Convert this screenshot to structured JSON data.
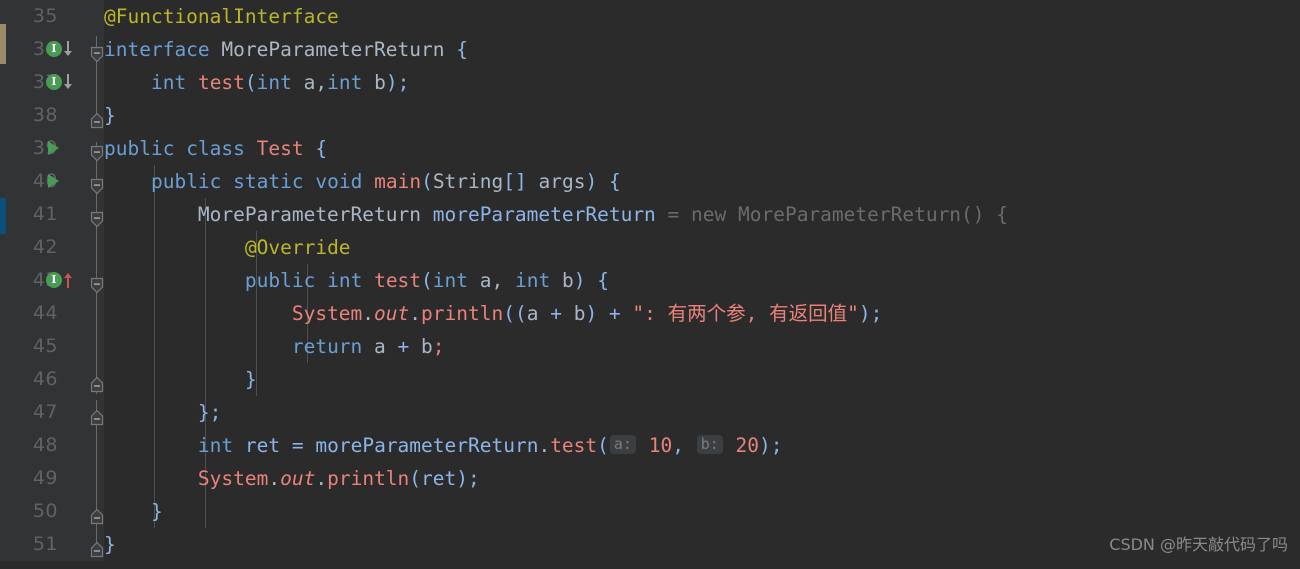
{
  "editor": {
    "background": "#2b2b2b",
    "gutter_background": "#313335",
    "first_line": 35,
    "last_line": 51
  },
  "watermark": {
    "text": "CSDN @昨天敲代码了吗"
  },
  "lines": [
    {
      "number": "35",
      "text": "@FunctionalInterface",
      "indent": 1,
      "gutter_icon": "",
      "fold": "",
      "vcs": "tan"
    },
    {
      "number": "36",
      "text": "interface MoreParameterReturn {",
      "indent": 0,
      "gutter_icon": "implemented-down",
      "fold": "collapse",
      "vcs": "tan"
    },
    {
      "number": "37",
      "text": "    int test(int a,int b);",
      "indent": 1,
      "gutter_icon": "implemented-down",
      "fold": "",
      "vcs": ""
    },
    {
      "number": "38",
      "text": "}",
      "indent": 0,
      "gutter_icon": "",
      "fold": "end",
      "vcs": ""
    },
    {
      "number": "39",
      "text": "public class Test {",
      "indent": 0,
      "gutter_icon": "run",
      "fold": "collapse",
      "vcs": ""
    },
    {
      "number": "40",
      "text": "    public static void main(String[] args) {",
      "indent": 1,
      "gutter_icon": "run",
      "fold": "collapse",
      "vcs": ""
    },
    {
      "number": "41",
      "text": "        MoreParameterReturn moreParameterReturn = new MoreParameterReturn() {",
      "indent": 2,
      "gutter_icon": "",
      "fold": "collapse",
      "vcs": "blue"
    },
    {
      "number": "42",
      "text": "            @Override",
      "indent": 3,
      "gutter_icon": "",
      "fold": "",
      "vcs": ""
    },
    {
      "number": "43",
      "text": "            public int test(int a, int b) {",
      "indent": 3,
      "gutter_icon": "overrides-up",
      "fold": "collapse",
      "vcs": ""
    },
    {
      "number": "44",
      "text": "                System.out.println((a + b) + \": 有两个参, 有返回值\");",
      "indent": 4,
      "gutter_icon": "",
      "fold": "",
      "vcs": ""
    },
    {
      "number": "45",
      "text": "                return a + b;",
      "indent": 4,
      "gutter_icon": "",
      "fold": "",
      "vcs": ""
    },
    {
      "number": "46",
      "text": "            }",
      "indent": 3,
      "gutter_icon": "",
      "fold": "end",
      "vcs": ""
    },
    {
      "number": "47",
      "text": "        };",
      "indent": 2,
      "gutter_icon": "",
      "fold": "end",
      "vcs": ""
    },
    {
      "number": "48",
      "text": "        int ret = moreParameterReturn.test( a: 10,  b: 20);",
      "indent": 2,
      "gutter_icon": "",
      "fold": "",
      "vcs": ""
    },
    {
      "number": "49",
      "text": "        System.out.println(ret);",
      "indent": 2,
      "gutter_icon": "",
      "fold": "",
      "vcs": ""
    },
    {
      "number": "50",
      "text": "    }",
      "indent": 1,
      "gutter_icon": "",
      "fold": "end",
      "vcs": ""
    },
    {
      "number": "51",
      "text": "}",
      "indent": 0,
      "gutter_icon": "",
      "fold": "end",
      "vcs": ""
    }
  ],
  "inlay_hints": {
    "param_a": "a:",
    "param_b": "b:"
  },
  "code_tokens": {
    "l35": [
      {
        "t": "@FunctionalInterface",
        "c": "anno"
      }
    ],
    "l36": [
      {
        "t": "interface",
        "c": "kw2"
      },
      {
        "t": " ",
        "c": "ident"
      },
      {
        "t": "MoreParameterReturn",
        "c": "type"
      },
      {
        "t": " ",
        "c": "ident"
      },
      {
        "t": "{",
        "c": "punct"
      }
    ],
    "l37": [
      {
        "t": "    ",
        "c": "ident"
      },
      {
        "t": "int",
        "c": "kw2"
      },
      {
        "t": " ",
        "c": "ident"
      },
      {
        "t": "test",
        "c": "meth"
      },
      {
        "t": "(",
        "c": "punct"
      },
      {
        "t": "int",
        "c": "kw2"
      },
      {
        "t": " a,",
        "c": "ident"
      },
      {
        "t": "int",
        "c": "kw2"
      },
      {
        "t": " b",
        "c": "ident"
      },
      {
        "t": ");",
        "c": "punct"
      }
    ],
    "l38": [
      {
        "t": "}",
        "c": "punct"
      }
    ],
    "l39": [
      {
        "t": "public",
        "c": "kw2"
      },
      {
        "t": " ",
        "c": "ident"
      },
      {
        "t": "class",
        "c": "kw2"
      },
      {
        "t": " ",
        "c": "ident"
      },
      {
        "t": "Test",
        "c": "cls"
      },
      {
        "t": " ",
        "c": "ident"
      },
      {
        "t": "{",
        "c": "punct"
      }
    ],
    "l40": [
      {
        "t": "    ",
        "c": "ident"
      },
      {
        "t": "public",
        "c": "kw2"
      },
      {
        "t": " ",
        "c": "ident"
      },
      {
        "t": "static",
        "c": "kw2"
      },
      {
        "t": " ",
        "c": "ident"
      },
      {
        "t": "void",
        "c": "kw2"
      },
      {
        "t": " ",
        "c": "ident"
      },
      {
        "t": "main",
        "c": "meth"
      },
      {
        "t": "(",
        "c": "punct"
      },
      {
        "t": "String",
        "c": "type"
      },
      {
        "t": "[] ",
        "c": "punct"
      },
      {
        "t": "args",
        "c": "ident"
      },
      {
        "t": ") {",
        "c": "punct"
      }
    ],
    "l41": [
      {
        "t": "        ",
        "c": "ident"
      },
      {
        "t": "MoreParameterReturn",
        "c": "type"
      },
      {
        "t": " ",
        "c": "ident"
      },
      {
        "t": "moreParameterReturn",
        "c": "var"
      },
      {
        "t": " = ",
        "c": "dim"
      },
      {
        "t": "new MoreParameterReturn() {",
        "c": "dim"
      }
    ],
    "l42": [
      {
        "t": "            ",
        "c": "ident"
      },
      {
        "t": "@Override",
        "c": "anno"
      }
    ],
    "l43": [
      {
        "t": "            ",
        "c": "ident"
      },
      {
        "t": "public",
        "c": "kw2"
      },
      {
        "t": " ",
        "c": "ident"
      },
      {
        "t": "int",
        "c": "kw2"
      },
      {
        "t": " ",
        "c": "ident"
      },
      {
        "t": "test",
        "c": "meth"
      },
      {
        "t": "(",
        "c": "punct"
      },
      {
        "t": "int",
        "c": "kw2"
      },
      {
        "t": " a, ",
        "c": "ident"
      },
      {
        "t": "int",
        "c": "kw2"
      },
      {
        "t": " b",
        "c": "ident"
      },
      {
        "t": ") {",
        "c": "punct"
      }
    ],
    "l44": [
      {
        "t": "                ",
        "c": "ident"
      },
      {
        "t": "System",
        "c": "meth"
      },
      {
        "t": ".",
        "c": "ident"
      },
      {
        "t": "out",
        "c": "fld"
      },
      {
        "t": ".",
        "c": "ident"
      },
      {
        "t": "println",
        "c": "meth"
      },
      {
        "t": "((",
        "c": "punct"
      },
      {
        "t": "a",
        "c": "ident"
      },
      {
        "t": " + ",
        "c": "op"
      },
      {
        "t": "b",
        "c": "ident"
      },
      {
        "t": ")",
        "c": "punct"
      },
      {
        "t": " + ",
        "c": "op"
      },
      {
        "t": "\": 有两个参, 有返回值\"",
        "c": "str"
      },
      {
        "t": ");",
        "c": "punct"
      }
    ],
    "l45": [
      {
        "t": "                ",
        "c": "ident"
      },
      {
        "t": "return",
        "c": "kw2"
      },
      {
        "t": " ",
        "c": "ident"
      },
      {
        "t": "a",
        "c": "ident"
      },
      {
        "t": " + ",
        "c": "op"
      },
      {
        "t": "b",
        "c": "ident"
      },
      {
        "t": ";",
        "c": "meth"
      }
    ],
    "l46": [
      {
        "t": "            }",
        "c": "punct"
      }
    ],
    "l47": [
      {
        "t": "        };",
        "c": "punct"
      }
    ],
    "l48": [
      {
        "t": "        ",
        "c": "ident"
      },
      {
        "t": "int",
        "c": "kw2"
      },
      {
        "t": " ",
        "c": "ident"
      },
      {
        "t": "ret",
        "c": "var"
      },
      {
        "t": " = ",
        "c": "op"
      },
      {
        "t": "moreParameterReturn",
        "c": "var"
      },
      {
        "t": ".",
        "c": "ident"
      },
      {
        "t": "test",
        "c": "meth"
      },
      {
        "t": "(",
        "c": "punct"
      }
    ],
    "l49": [
      {
        "t": "        ",
        "c": "ident"
      },
      {
        "t": "System",
        "c": "meth"
      },
      {
        "t": ".",
        "c": "ident"
      },
      {
        "t": "out",
        "c": "fld"
      },
      {
        "t": ".",
        "c": "ident"
      },
      {
        "t": "println",
        "c": "meth"
      },
      {
        "t": "(",
        "c": "punct"
      },
      {
        "t": "ret",
        "c": "var"
      },
      {
        "t": ");",
        "c": "punct"
      }
    ],
    "l50": [
      {
        "t": "    }",
        "c": "punct"
      }
    ],
    "l51": [
      {
        "t": "}",
        "c": "punct"
      }
    ]
  }
}
